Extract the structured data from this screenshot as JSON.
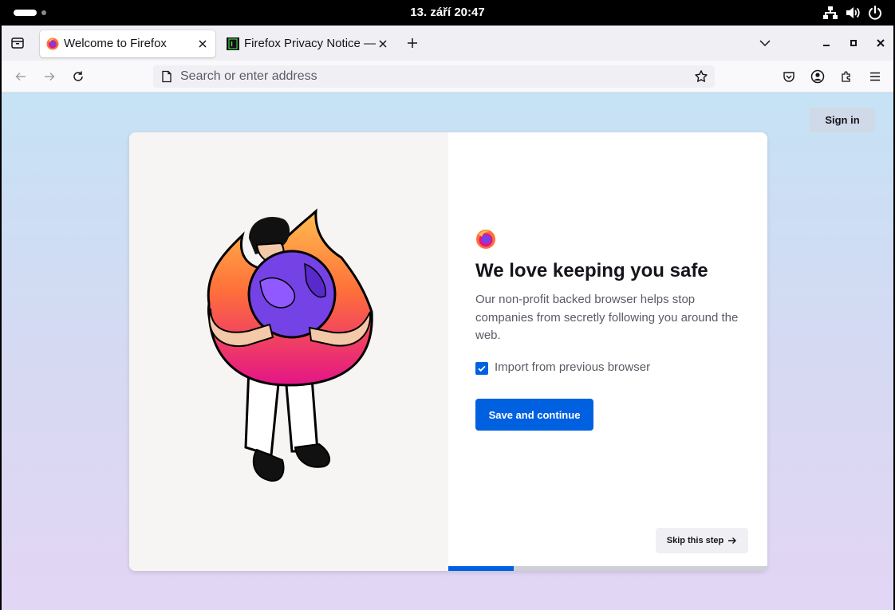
{
  "system_bar": {
    "clock": "13. září  20:47"
  },
  "tabs": [
    {
      "title": "Welcome to Firefox",
      "active": true
    },
    {
      "title": "Firefox Privacy Notice — Mozilla",
      "active": false
    }
  ],
  "urlbar": {
    "placeholder": "Search or enter address"
  },
  "page": {
    "sign_in": "Sign in",
    "heading": "We love keeping you safe",
    "subtitle": "Our non-profit backed browser helps stop companies from secretly following you around the web.",
    "import_label": "Import from previous browser",
    "import_checked": true,
    "primary_button": "Save and continue",
    "skip_button": "Skip this step",
    "progress": 0.205
  },
  "colors": {
    "accent": "#0061e0",
    "heading": "#15141a",
    "body_text": "#5b5b66"
  },
  "icons": [
    "network-icon",
    "volume-icon",
    "power-icon",
    "firefox-view-icon",
    "firefox-logo-icon",
    "close-icon",
    "new-tab-icon",
    "tab-list-chevron-icon",
    "minimize-icon",
    "maximize-icon",
    "back-arrow-icon",
    "forward-arrow-icon",
    "reload-icon",
    "page-icon",
    "bookmark-star-icon",
    "pocket-icon",
    "account-icon",
    "extensions-icon",
    "hamburger-menu-icon",
    "arrow-right-icon",
    "check-icon"
  ]
}
